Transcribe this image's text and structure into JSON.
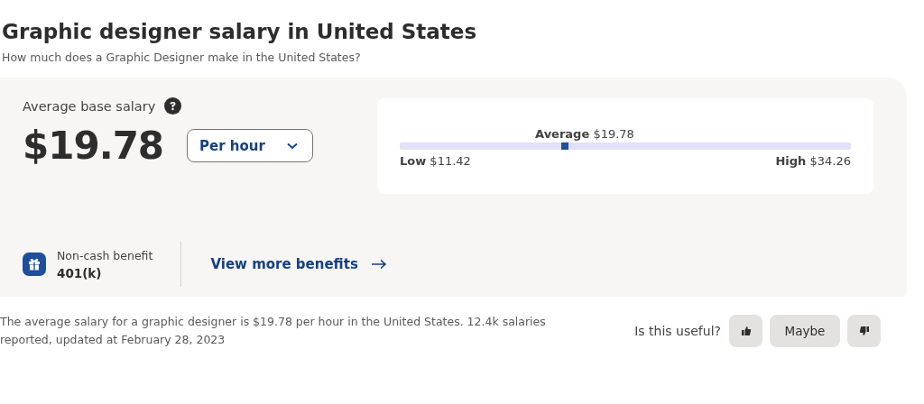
{
  "title": "Graphic designer salary in United States",
  "subtitle": "How much does a Graphic Designer make in the United States?",
  "salary": {
    "label": "Average base salary",
    "amount": "$19.78",
    "period": "Per hour"
  },
  "range": {
    "average": "**Average** $19.78",
    "level": 0.366,
    "low": "**Low** $11.42",
    "high": "**High** $34.26"
  },
  "benefit": {
    "label": "Non-cash benefit",
    "value": "401(k)",
    "link": "View more benefits"
  },
  "note": "The average salary for a graphic designer is $19.78 per hour in the United States.  12.4k salaries reported, updated at February 28, 2023",
  "feedback": {
    "question": "Is this useful?",
    "maybe": "Maybe"
  }
}
